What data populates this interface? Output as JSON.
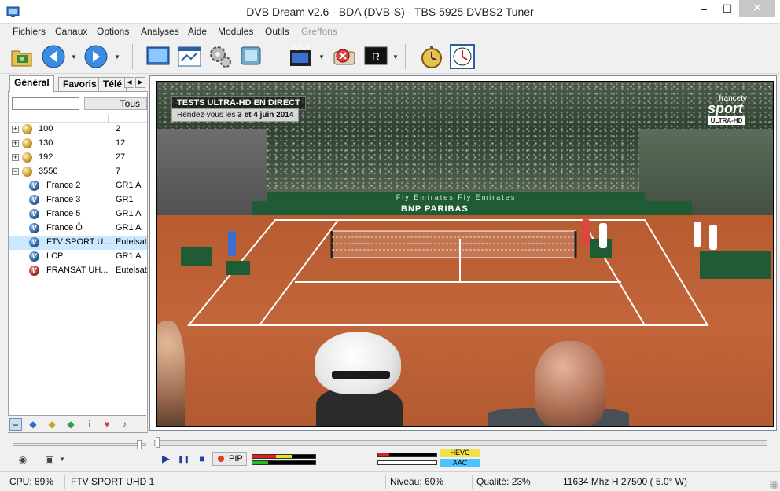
{
  "window": {
    "title": "DVB Dream v2.6 - BDA (DVB-S)  -  TBS 5925 DVBS2 Tuner",
    "min_glyph": "–",
    "max_glyph": "☐",
    "close_glyph": "✕"
  },
  "menu": {
    "items": [
      "Fichiers",
      "Canaux",
      "Options",
      "Analyses",
      "Aide",
      "Modules",
      "Outils",
      "Greffons"
    ]
  },
  "toolbar": {
    "icons": [
      "open-icon",
      "back-icon",
      "forward-icon",
      "screen-icon",
      "window-icon",
      "settings-icon",
      "display-icon",
      "record-icon",
      "stop-record-icon",
      "teletext-icon",
      "timer-icon",
      "clock-icon"
    ]
  },
  "tabs": {
    "items": [
      "Général",
      "Favoris",
      "Télé"
    ],
    "scroll_left": "◀",
    "scroll_right": "▶"
  },
  "filter": {
    "input_value": "",
    "combo_value": "Tous"
  },
  "channel_tree": {
    "satellites": [
      {
        "name": "100",
        "count": "2",
        "expander": "+"
      },
      {
        "name": "130",
        "count": "12",
        "expander": "+"
      },
      {
        "name": "192",
        "count": "27",
        "expander": "+"
      },
      {
        "name": "3550",
        "count": "7",
        "expander": "−"
      }
    ],
    "channels": [
      {
        "name": "France 2",
        "provider": "GR1 A"
      },
      {
        "name": "France 3",
        "provider": "GR1"
      },
      {
        "name": "France 5",
        "provider": "GR1 A"
      },
      {
        "name": "France Ô",
        "provider": "GR1 A"
      },
      {
        "name": "FTV SPORT U...",
        "provider": "Eutelsat"
      },
      {
        "name": "LCP",
        "provider": "GR1 A"
      },
      {
        "name": "FRANSAT UH...",
        "provider": "Eutelsat"
      }
    ],
    "selected_index": 4
  },
  "video_overlay": {
    "headline": "TESTS ULTRA-HD EN DIRECT",
    "subline_prefix": "Rendez-vous les ",
    "subline_bold": "3 et 4 juin 2014",
    "channel_brand": "francetv",
    "channel_name": "sport",
    "channel_badge": "ULTRA-HD",
    "banner_text": "Fly Emirates  Fly Emirates",
    "sponsor": "BNP PARIBAS"
  },
  "player": {
    "play_glyph": "▶",
    "pause_glyph": "❚❚",
    "stop_glyph": "■",
    "pip_label": "PIP",
    "video_codec": "HEVC",
    "audio_codec": "AAC",
    "colors": {
      "meter_red": "#e02020",
      "meter_yellow": "#e8e020",
      "meter_green": "#20c020",
      "hevc_bg": "#f5e04a",
      "aac_bg": "#4cc3ff"
    }
  },
  "statusbar": {
    "cpu": "CPU: 89%",
    "channel": "FTV SPORT UHD 1",
    "level": "Niveau: 60%",
    "quality": "Qualité: 23%",
    "tuning": "11634 Mhz  H  27500  ( 5.0° W)"
  }
}
